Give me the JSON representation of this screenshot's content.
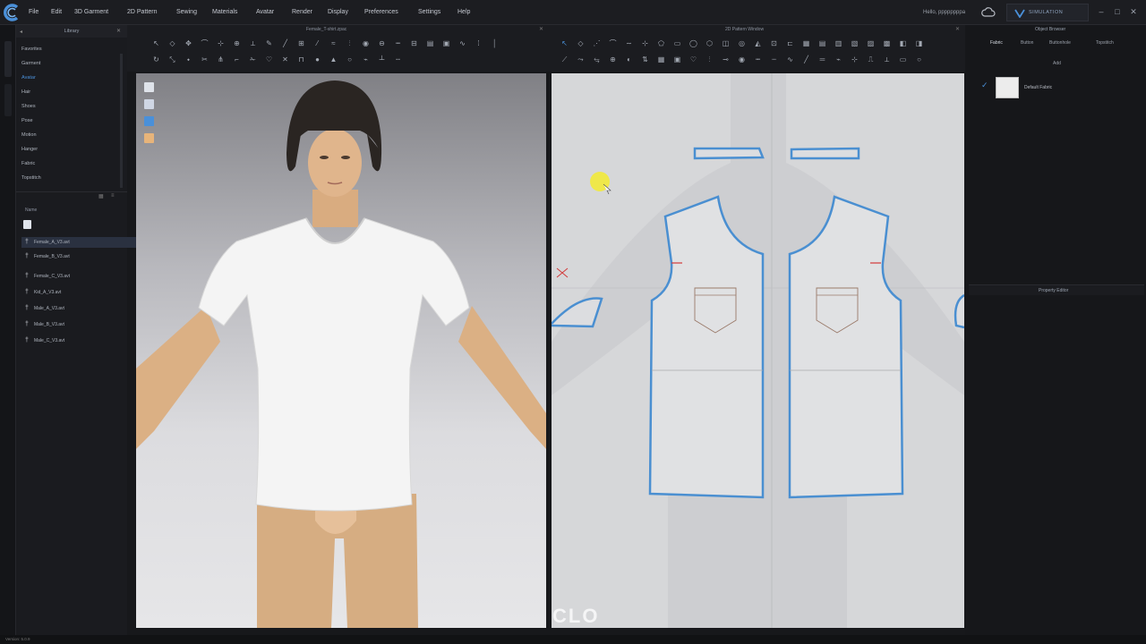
{
  "app": {
    "name": "CLO",
    "accent": "#4a90d9"
  },
  "menu": [
    "File",
    "Edit",
    "3D Garment",
    "2D Pattern",
    "Sewing",
    "Materials",
    "Avatar",
    "Render",
    "Display",
    "Preferences",
    "Settings",
    "Help"
  ],
  "user": "Hello, ppppppppa",
  "simulation_label": "SIMULATION",
  "library": {
    "title": "Library",
    "categories": [
      "Favorites",
      "Garment",
      "Avatar",
      "Hair",
      "Shoes",
      "Pose",
      "Motion",
      "Hanger",
      "Fabric",
      "Topstitch"
    ],
    "folder_label": "Name",
    "files": [
      "Female_A_V3.avt",
      "Female_B_V3.avt",
      "Female_C_V3.avt",
      "Kid_A_V3.avt",
      "Male_A_V3.avt",
      "Male_B_V3.avt",
      "Male_C_V3.avt"
    ]
  },
  "view3d": {
    "title": "Female_T-shirt.zpac"
  },
  "view2d": {
    "title": "2D Pattern Window"
  },
  "right_panel": {
    "title": "Object Browser",
    "tabs": [
      "Fabric",
      "Button",
      "Buttonhole",
      "Topstitch"
    ],
    "add_label": "Add",
    "fabric_item": "Default Fabric",
    "property_editor": "Property Editor"
  },
  "status": {
    "version": "Version: 5.0.9"
  },
  "watermark": "CLO"
}
